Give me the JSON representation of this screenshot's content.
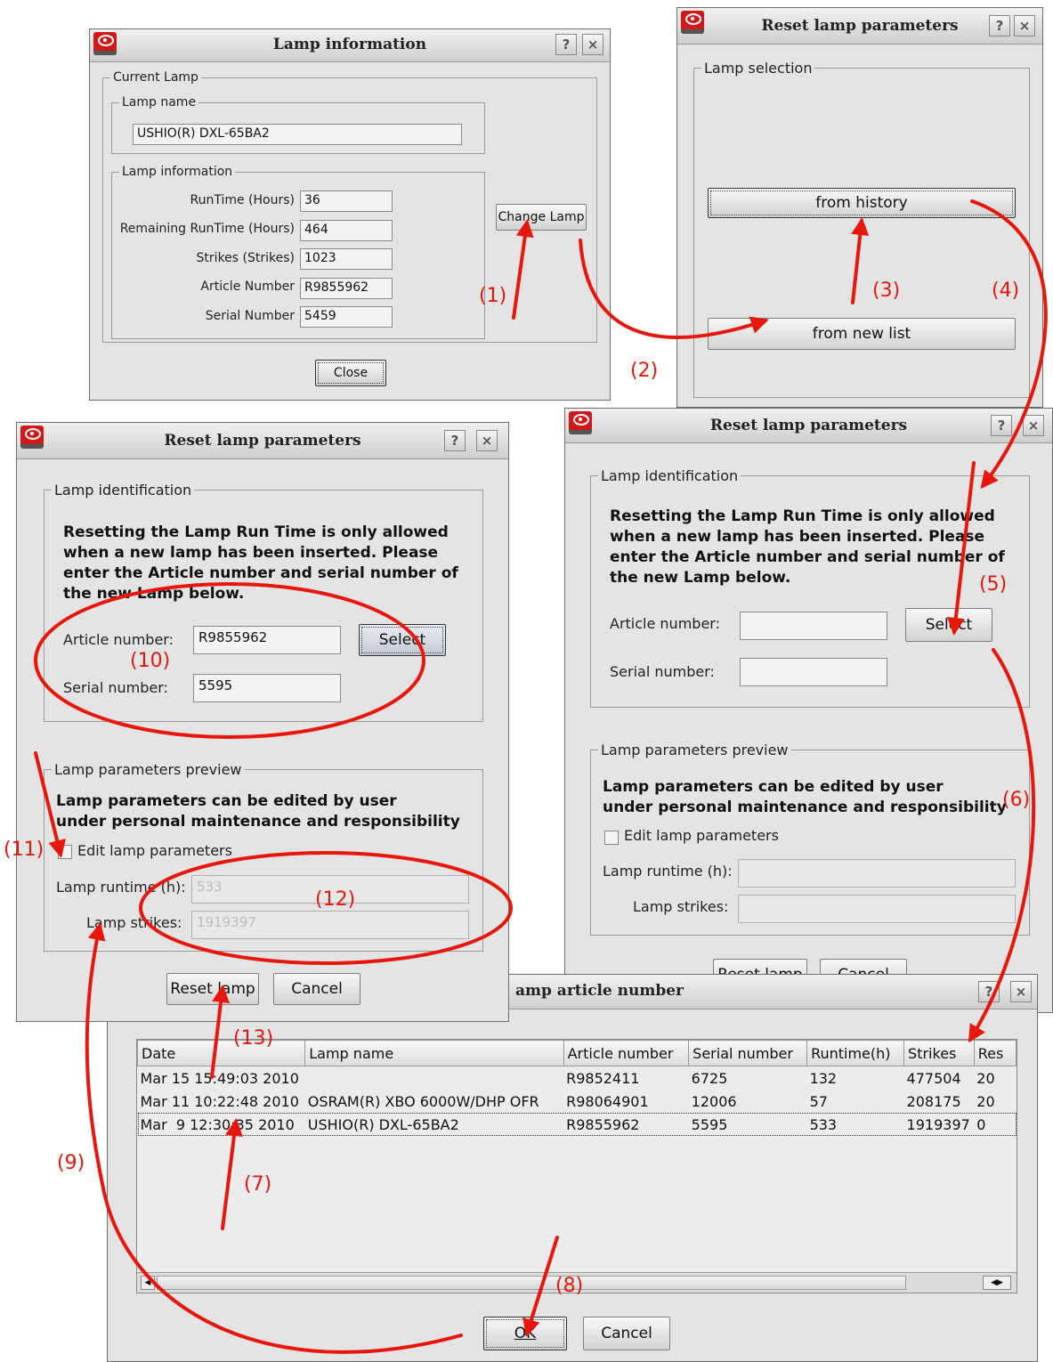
{
  "lamp_info": {
    "title": "Lamp information",
    "help_btn": "?",
    "close_btn": "×",
    "current_lamp_legend": "Current Lamp",
    "lamp_name_legend": "Lamp name",
    "lamp_name_value": "USHIO(R) DXL-65BA2",
    "lamp_information_legend": "Lamp information",
    "fields": [
      {
        "label": "RunTime  (Hours)",
        "value": "36"
      },
      {
        "label": "Remaining RunTime  (Hours)",
        "value": "464"
      },
      {
        "label": "Strikes  (Strikes)",
        "value": "1023"
      },
      {
        "label": "Article Number",
        "value": "R9855962"
      },
      {
        "label": "Serial Number",
        "value": "5459"
      }
    ],
    "change_lamp_btn": "Change Lamp",
    "close_dialog_btn": "Close"
  },
  "reset_selection": {
    "title": "Reset lamp parameters",
    "lamp_selection_legend": "Lamp selection",
    "from_history_btn": "from history",
    "from_new_list_btn": "from new list"
  },
  "reset_left": {
    "title": "Reset lamp parameters",
    "identification_legend": "Lamp identification",
    "message": "Resetting the Lamp Run Time is only allowed when a new lamp has been inserted. Please enter the Article number and serial number of the new Lamp below.",
    "article_label": "Article number:",
    "article_value": "R9855962",
    "serial_label": "Serial number:",
    "serial_value": "5595",
    "select_btn": "Select",
    "preview_legend": "Lamp parameters preview",
    "preview_note_1": "Lamp parameters can be edited by user",
    "preview_note_2": "under personal maintenance and responsibility",
    "edit_checkbox_label": "Edit lamp parameters",
    "runtime_label": "Lamp runtime (h):",
    "runtime_value": "533",
    "strikes_label": "Lamp strikes:",
    "strikes_value": "1919397",
    "reset_btn": "Reset lamp",
    "cancel_btn": "Cancel"
  },
  "reset_right": {
    "title": "Reset lamp parameters",
    "identification_legend": "Lamp identification",
    "message": "Resetting the Lamp Run Time is only allowed when a new lamp has been inserted. Please enter the Article number and serial number of the new Lamp below.",
    "article_label": "Article number:",
    "serial_label": "Serial number:",
    "select_btn": "Select",
    "preview_legend": "Lamp parameters preview",
    "preview_note_1": "Lamp parameters can be edited by user",
    "preview_note_2": "under personal maintenance and responsibility",
    "edit_checkbox_label": "Edit lamp parameters",
    "runtime_label": "Lamp runtime (h):",
    "strikes_label": "Lamp strikes:",
    "reset_btn": "Reset lamp",
    "cancel_btn": "Cancel"
  },
  "history": {
    "title": "amp article number",
    "columns": [
      "Date",
      "Lamp name",
      "Article number",
      "Serial number",
      "Runtime(h)",
      "Strikes",
      "Res"
    ],
    "rows": [
      [
        "Mar 15 15:49:03 2010",
        "",
        "R9852411",
        "6725",
        "132",
        "477504",
        "20"
      ],
      [
        "Mar 11 10:22:48 2010",
        "OSRAM(R) XBO 6000W/DHP OFR",
        "R98064901",
        "12006",
        "57",
        "208175",
        "20"
      ],
      [
        "Mar  9 12:30:35 2010",
        "USHIO(R) DXL-65BA2",
        "R9855962",
        "5595",
        "533",
        "1919397",
        "0"
      ]
    ],
    "ok_btn": "OK",
    "cancel_btn": "Cancel"
  },
  "annotations": {
    "a1": "(1)",
    "a2": "(2)",
    "a3": "(3)",
    "a4": "(4)",
    "a5": "(5)",
    "a6": "(6)",
    "a7": "(7)",
    "a8": "(8)",
    "a9": "(9)",
    "a10": "(10)",
    "a11": "(11)",
    "a12": "(12)",
    "a13": "(13)"
  },
  "colors": {
    "annotation": "#e8170d",
    "dialog_bg": "#e4e4e4",
    "app_icon": "#d21818"
  }
}
